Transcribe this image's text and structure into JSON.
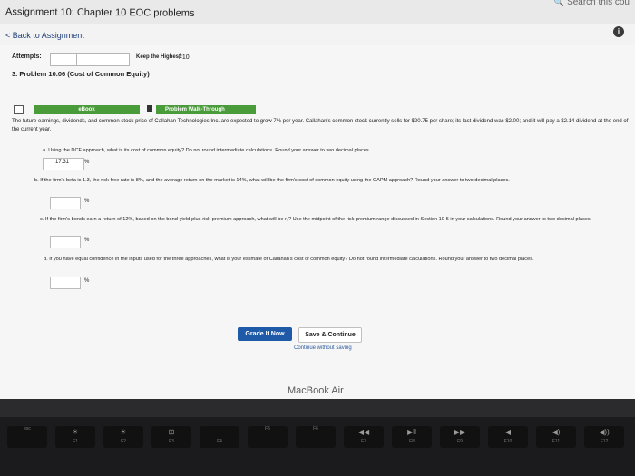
{
  "window": {
    "title": "Assignment 10: Chapter 10 EOC problems",
    "search_hint": "Search this cou",
    "info_icon": "i"
  },
  "nav": {
    "back_label": "< Back to Assignment"
  },
  "attempts": {
    "label": "Attempts:",
    "keep_label": "Keep the Highest:",
    "keep_value": "/ 10"
  },
  "problem": {
    "title": "3. Problem 10.06 (Cost of Common Equity)",
    "tabs": {
      "ebook": "eBook",
      "walkthrough": "Problem Walk-Through"
    },
    "intro": "The future earnings, dividends, and common stock price of Callahan Technologies Inc. are expected to grow 7% per year. Callahan's common stock currently sells for $20.75 per share; its last dividend was $2.00; and it will pay a $2.14 dividend at the end of the current year.",
    "questions": [
      {
        "text": "a. Using the DCF approach, what is its cost of common equity? Do not round intermediate calculations. Round your answer to two decimal places.",
        "answer": "17.31",
        "unit": "%"
      },
      {
        "text": "b. If the firm's beta is 1.3, the risk-free rate is 8%, and the average return on the market is 14%, what will be the firm's cost of common equity using the CAPM approach? Round your answer to two decimal places.",
        "answer": "",
        "unit": "%"
      },
      {
        "text": "c. If the firm's bonds earn a return of 12%, based on the bond-yield-plus-risk-premium approach, what will be rₛ? Use the midpoint of the risk premium range discussed in Section 10-5 in your calculations. Round your answer to two decimal places.",
        "answer": "",
        "unit": "%"
      },
      {
        "text": "d. If you have equal confidence in the inputs used for the three approaches, what is your estimate of Callahan's cost of common equity? Do not round intermediate calculations. Round your answer to two decimal places.",
        "answer": "",
        "unit": "%"
      }
    ]
  },
  "actions": {
    "grade": "Grade It Now",
    "save": "Save & Continue",
    "continue": "Continue without saving"
  },
  "device": {
    "bezel_label": "MacBook Air"
  },
  "keyboard": [
    {
      "glyph": "",
      "fn": "esc"
    },
    {
      "glyph": "☀",
      "fn": "F1"
    },
    {
      "glyph": "☀",
      "fn": "F2"
    },
    {
      "glyph": "⊞",
      "fn": "F3"
    },
    {
      "glyph": "⋯",
      "fn": "F4"
    },
    {
      "glyph": "",
      "fn": "F5"
    },
    {
      "glyph": "",
      "fn": "F6"
    },
    {
      "glyph": "◀◀",
      "fn": "F7"
    },
    {
      "glyph": "▶ll",
      "fn": "F8"
    },
    {
      "glyph": "▶▶",
      "fn": "F9"
    },
    {
      "glyph": "◀",
      "fn": "F10"
    },
    {
      "glyph": "◀)",
      "fn": "F11"
    },
    {
      "glyph": "◀))",
      "fn": "F12"
    }
  ]
}
